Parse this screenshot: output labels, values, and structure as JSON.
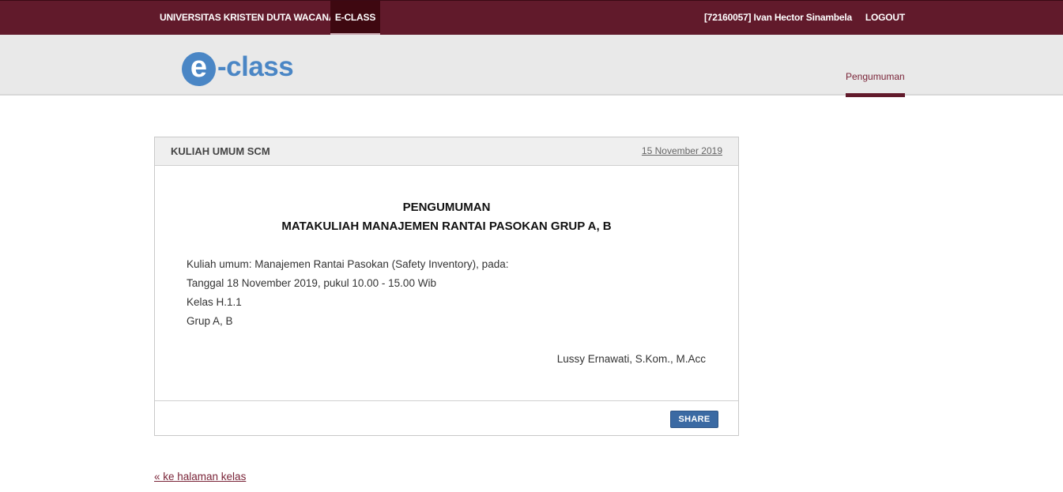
{
  "topbar": {
    "brand": "UNIVERSITAS KRISTEN DUTA WACANA",
    "active_tab": "E-CLASS",
    "user": "[72160057] Ivan Hector Sinambela",
    "logout": "LOGOUT"
  },
  "header": {
    "logo_letter": "e",
    "logo_text": "-class",
    "tab": "Pengumuman"
  },
  "announcement": {
    "title": "KULIAH UMUM SCM",
    "date": "15 November 2019",
    "heading_line1": "PENGUMUMAN",
    "heading_line2": "MATAKULIAH MANAJEMEN RANTAI PASOKAN GRUP A, B",
    "lines": [
      "Kuliah umum: Manajemen Rantai Pasokan (Safety Inventory), pada:",
      "Tanggal 18 November 2019, pukul 10.00 - 15.00 Wib",
      "Kelas H.1.1",
      "Grup A, B"
    ],
    "signature": "Lussy Ernawati, S.Kom., M.Acc",
    "share_label": "SHARE"
  },
  "back_link": "« ke halaman kelas",
  "colors": {
    "primary": "#611a2b",
    "logo_blue": "#4a86c5",
    "share_button": "#3b6aa3"
  }
}
